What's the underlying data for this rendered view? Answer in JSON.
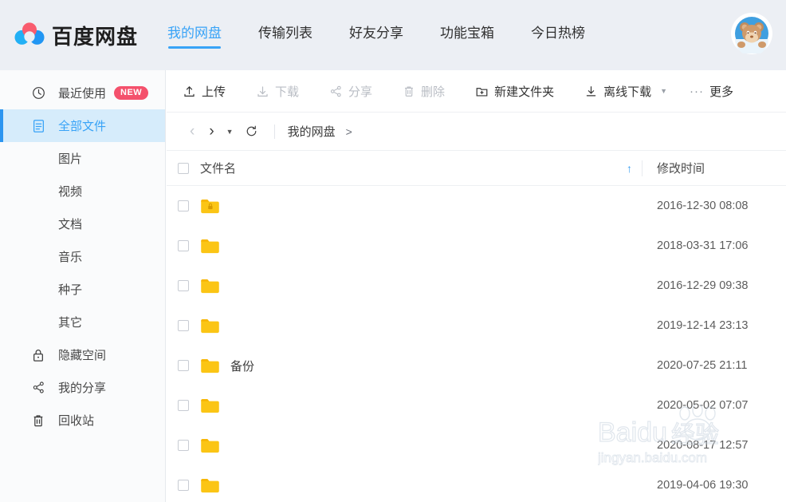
{
  "header": {
    "logo_icon": "baidu-cloud-logo-icon",
    "brand": "百度网盘",
    "avatar_icon": "bear-avatar-icon",
    "tabs": [
      {
        "label": "我的网盘",
        "active": true
      },
      {
        "label": "传输列表",
        "active": false
      },
      {
        "label": "好友分享",
        "active": false
      },
      {
        "label": "功能宝箱",
        "active": false
      },
      {
        "label": "今日热榜",
        "active": false
      }
    ]
  },
  "sidebar": {
    "items": [
      {
        "label": "最近使用",
        "icon": "clock-icon",
        "badge": "NEW",
        "active": false,
        "sub": false
      },
      {
        "label": "全部文件",
        "icon": "file-list-icon",
        "badge": "",
        "active": true,
        "sub": false
      },
      {
        "label": "图片",
        "icon": "",
        "badge": "",
        "active": false,
        "sub": true
      },
      {
        "label": "视频",
        "icon": "",
        "badge": "",
        "active": false,
        "sub": true
      },
      {
        "label": "文档",
        "icon": "",
        "badge": "",
        "active": false,
        "sub": true
      },
      {
        "label": "音乐",
        "icon": "",
        "badge": "",
        "active": false,
        "sub": true
      },
      {
        "label": "种子",
        "icon": "",
        "badge": "",
        "active": false,
        "sub": true
      },
      {
        "label": "其它",
        "icon": "",
        "badge": "",
        "active": false,
        "sub": true
      },
      {
        "label": "隐藏空间",
        "icon": "lock-icon",
        "badge": "",
        "active": false,
        "sub": false
      },
      {
        "label": "我的分享",
        "icon": "share-icon",
        "badge": "",
        "active": false,
        "sub": false
      },
      {
        "label": "回收站",
        "icon": "trash-icon",
        "badge": "",
        "active": false,
        "sub": false
      }
    ]
  },
  "toolbar": {
    "buttons": [
      {
        "label": "上传",
        "icon": "upload-icon",
        "disabled": false
      },
      {
        "label": "下载",
        "icon": "download-icon",
        "disabled": true
      },
      {
        "label": "分享",
        "icon": "share-icon",
        "disabled": true
      },
      {
        "label": "删除",
        "icon": "trash-icon",
        "disabled": true
      },
      {
        "label": "新建文件夹",
        "icon": "new-folder-icon",
        "disabled": false
      },
      {
        "label": "离线下载",
        "icon": "offline-download-icon",
        "disabled": false
      }
    ],
    "more_label": "更多",
    "more_icon": "ellipsis-icon",
    "offline_caret_icon": "caret-down-icon"
  },
  "breadcrumb": {
    "back_icon": "chevron-left-icon",
    "forward_icon": "chevron-right-icon",
    "history_caret_icon": "caret-down-icon",
    "refresh_icon": "refresh-icon",
    "path": "我的网盘",
    "separator": ">"
  },
  "table": {
    "columns": {
      "name": "文件名",
      "time": "修改时间"
    },
    "sort_icon": "sort-asc-arrow-icon",
    "rows": [
      {
        "name": "",
        "redacted": true,
        "redact_width": 118,
        "name_offset": 0,
        "locked": true,
        "time": "2016-12-30 08:08"
      },
      {
        "name": "",
        "redacted": true,
        "redact_width": 200,
        "name_offset": 0,
        "locked": false,
        "time": "2018-03-31 17:06"
      },
      {
        "name": "",
        "redacted": true,
        "redact_width": 82,
        "name_offset": 0,
        "locked": false,
        "time": "2016-12-29 09:38"
      },
      {
        "name": "",
        "redacted": true,
        "redact_width": 98,
        "name_offset": 0,
        "locked": false,
        "time": "2019-12-14 23:13"
      },
      {
        "name": "备份",
        "redacted": false,
        "redact_width": 0,
        "name_offset": 0,
        "locked": false,
        "time": "2020-07-25 21:11"
      },
      {
        "name": "",
        "redacted": true,
        "redact_width": 82,
        "name_offset": 0,
        "locked": false,
        "time": "2020-05-02 07:07"
      },
      {
        "name": "",
        "redacted": true,
        "redact_width": 46,
        "name_offset": 0,
        "locked": false,
        "time": "2020-08-17 12:57"
      },
      {
        "name": "",
        "redacted": true,
        "redact_width": 62,
        "name_offset": 0,
        "locked": false,
        "time": "2019-04-06 19:30"
      }
    ]
  },
  "watermark": {
    "brand": "Baidu",
    "suffix": "经验",
    "url": "jingyan.baidu.com",
    "paw_icon": "paw-print-icon"
  },
  "colors": {
    "accent": "#38a3f7",
    "sidebar_active_bg": "#d6ecfb",
    "badge": "#f4516c",
    "folder": "#fbc515",
    "redaction": "#fc2b2b",
    "header_bg": "#eceff4"
  }
}
